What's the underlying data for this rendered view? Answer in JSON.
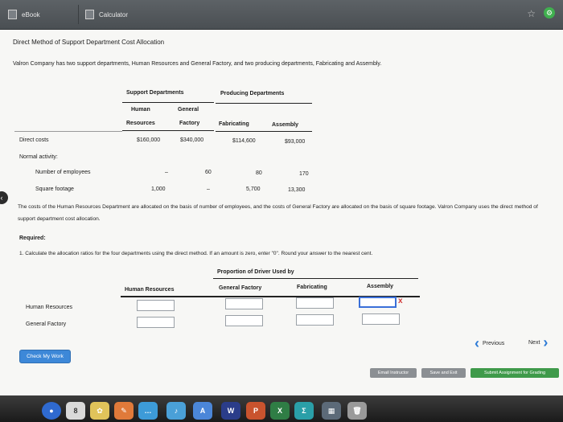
{
  "tabs": {
    "ebook": "eBook",
    "calculator": "Calculator"
  },
  "title": "Direct Method of Support Department Cost Allocation",
  "intro": "Valron Company has two support departments, Human Resources and General Factory, and two producing departments, Fabricating and Assembly.",
  "table": {
    "group_support": "Support Departments",
    "group_producing": "Producing Departments",
    "col_hr_1": "Human",
    "col_hr_2": "Resources",
    "col_gf_1": "General",
    "col_gf_2": "Factory",
    "col_fab": "Fabricating",
    "col_asm": "Assembly",
    "rows": {
      "direct_costs": {
        "label": "Direct costs",
        "hr": "$160,000",
        "gf": "$340,000",
        "fab": "$114,600",
        "asm": "$93,000"
      },
      "normal_activity": {
        "label": "Normal activity:"
      },
      "employees": {
        "label": "Number of employees",
        "hr": "–",
        "gf": "60",
        "fab": "80",
        "asm": "170"
      },
      "sqft": {
        "label": "Square footage",
        "hr": "1,000",
        "gf": "–",
        "fab": "5,700",
        "asm": "13,300"
      }
    }
  },
  "paragraph": "The costs of the Human Resources Department are allocated on the basis of number of employees, and the costs of General Factory are allocated on the basis of square footage. Valron Company uses the direct method of support department cost allocation.",
  "required_label": "Required:",
  "instruction": "1. Calculate the allocation ratios for the four departments using the direct method. If an amount is zero, enter \"0\". Round your answer to the nearest cent.",
  "answer_table": {
    "caption": "Proportion of Driver Used by",
    "headers": [
      "Human Resources",
      "General Factory",
      "Fabricating",
      "Assembly"
    ],
    "row_labels": [
      "Human Resources",
      "General Factory"
    ],
    "x_mark": "x"
  },
  "nav": {
    "previous": "Previous",
    "next": "Next"
  },
  "check_my_work": "Check My Work",
  "footer": {
    "email": "Email Instructor",
    "save": "Save and Exit",
    "submit": "Submit Assignment for Grading"
  },
  "dock": {
    "app_w": "W",
    "app_p": "P",
    "app_x": "X",
    "app_sigma": "Σ"
  },
  "colors": {
    "accent": "#3d88d8",
    "error": "#d23b3b",
    "submit": "#3f9a4a"
  }
}
